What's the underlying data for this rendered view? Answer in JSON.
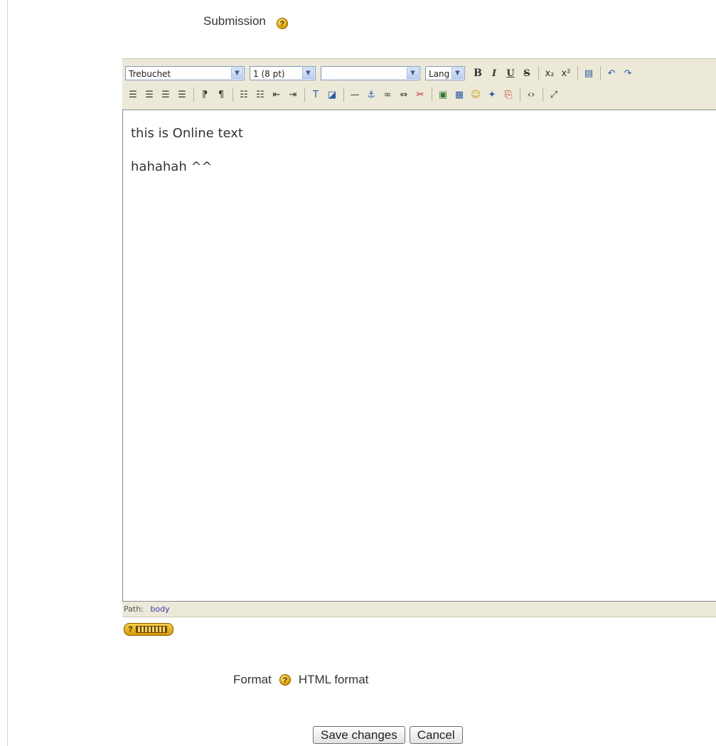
{
  "submission_label": "Submission",
  "help_glyph": "?",
  "editor": {
    "font_select": "Trebuchet",
    "size_select": "1 (8 pt)",
    "style_select": "",
    "lang_select": "Lang",
    "bold": "B",
    "italic": "I",
    "underline": "U",
    "strike": "S",
    "content_lines": [
      "this is Online text",
      "hahahah ^^"
    ],
    "path_label": "Path:",
    "path_value": "body"
  },
  "format": {
    "label": "Format",
    "value": "HTML format"
  },
  "actions": {
    "save": "Save changes",
    "cancel": "Cancel"
  },
  "icons": {
    "help": "help-icon",
    "keyboard_help": "keyboard-help-icon"
  }
}
